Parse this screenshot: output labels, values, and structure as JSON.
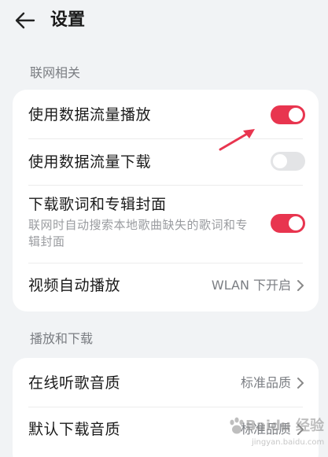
{
  "header": {
    "title": "设置",
    "back_icon": "arrow-left-icon"
  },
  "sections": [
    {
      "label": "联网相关",
      "rows": [
        {
          "title": "使用数据流量播放",
          "control": "toggle",
          "state": "on"
        },
        {
          "title": "使用数据流量下载",
          "control": "toggle",
          "state": "off"
        },
        {
          "title": "下载歌词和专辑封面",
          "subtitle": "联网时自动搜索本地歌曲缺失的歌词和专辑封面",
          "control": "toggle",
          "state": "on"
        },
        {
          "title": "视频自动播放",
          "control": "value",
          "value": "WLAN 下开启"
        }
      ]
    },
    {
      "label": "播放和下载",
      "rows": [
        {
          "title": "在线听歌音质",
          "control": "value",
          "value": "标准品质"
        },
        {
          "title": "默认下载音质",
          "control": "value",
          "value": "标准品质"
        }
      ]
    }
  ],
  "colors": {
    "accent": "#e8354f",
    "toggle_off": "#e3e4e6",
    "background": "#f1f3f5",
    "card": "#ffffff",
    "annotation_arrow": "#e8354f"
  },
  "watermark": {
    "text": "Baidu 经验",
    "subtext": "jingyan.baidu.com"
  }
}
